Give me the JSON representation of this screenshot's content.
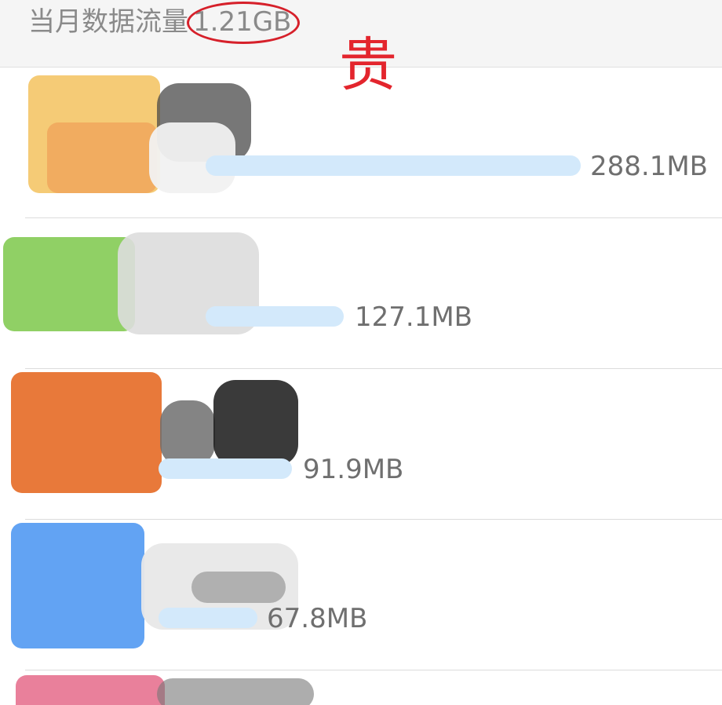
{
  "header": {
    "label": "当月数据流量",
    "total": "1.21GB"
  },
  "annotation": {
    "text": "贵"
  },
  "apps": [
    {
      "usage": "288.1MB",
      "icon_color": "#f2b24a",
      "usage_fraction": 1.0
    },
    {
      "usage": "127.1MB",
      "icon_color": "#7cc84a",
      "usage_fraction": 0.441
    },
    {
      "usage": "91.9MB",
      "icon_color": "#e5661f",
      "usage_fraction": 0.319
    },
    {
      "usage": "67.8MB",
      "icon_color": "#3f8ff0",
      "usage_fraction": 0.235
    },
    {
      "usage": "",
      "icon_color": "#e56a8a",
      "usage_fraction": null
    }
  ]
}
